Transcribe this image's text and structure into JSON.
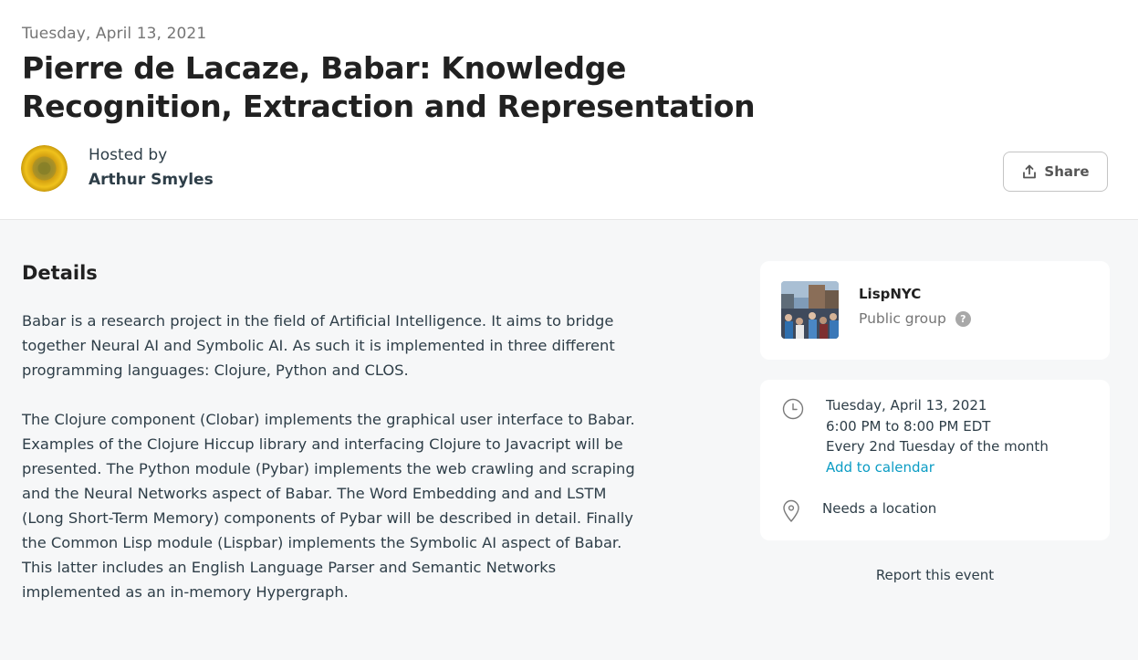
{
  "event": {
    "date": "Tuesday, April 13, 2021",
    "title": "Pierre de Lacaze, Babar: Knowledge Recognition, Extraction and Representation"
  },
  "host": {
    "hosted_by_label": "Hosted by",
    "name": "Arthur Smyles",
    "avatar_icon": "sunflower-avatar"
  },
  "actions": {
    "share_label": "Share",
    "share_icon": "share-icon"
  },
  "details": {
    "heading": "Details",
    "paragraphs": [
      "Babar is a research project in the field of Artificial Intelligence. It aims to bridge together Neural AI and Symbolic AI. As such it is implemented in three different programming languages: Clojure, Python and CLOS.",
      "The Clojure component (Clobar) implements the graphical user interface to Babar. Examples of the Clojure Hiccup library and interfacing Clojure to Javacript will be presented. The Python module (Pybar) implements the web crawling and scraping and the Neural Networks aspect of Babar. The Word Embedding and and LSTM (Long Short-Term Memory) components of Pybar will be described in detail. Finally the Common Lisp module (Lispbar) implements the Symbolic AI aspect of Babar. This latter includes an English Language Parser and Semantic Networks implemented as an in-memory Hypergraph."
    ]
  },
  "group": {
    "name": "LispNYC",
    "type": "Public group",
    "help_glyph": "?"
  },
  "when": {
    "date": "Tuesday, April 13, 2021",
    "time": "6:00 PM to 8:00 PM EDT",
    "recurrence": "Every 2nd Tuesday of the month",
    "add_to_calendar": "Add to calendar",
    "location": "Needs a location"
  },
  "report_label": "Report this event",
  "colors": {
    "link": "#0b9cc4",
    "background": "#f6f7f8",
    "card": "#ffffff"
  }
}
